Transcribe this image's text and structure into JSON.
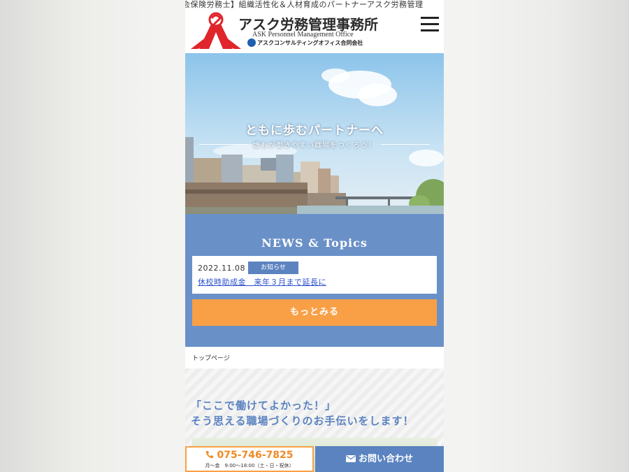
{
  "ticker": "会保険労務士】組織活性化＆人材育成のパートナーアスク労務管理",
  "header": {
    "logo_name_ja": "アスク労務管理事務所",
    "logo_name_en": "ASK Personnel Management Office",
    "logo_company": "アスクコンサルティングオフィス合同会社",
    "menu_icon": "hamburger-menu-icon"
  },
  "hero": {
    "title": "ともに歩むパートナーへ",
    "subtitle": "誰もが働きやすい職場をつくろう！"
  },
  "news": {
    "heading": "NEWS & Topics",
    "items": [
      {
        "date": "2022.11.08",
        "category": "お知らせ",
        "title": "休校時助成金　来年３月まで延長に"
      }
    ],
    "more_label": "もっとみる"
  },
  "breadcrumb": "トップページ",
  "intro": {
    "line1": "「ここで働けてよかった！」",
    "line2": "そう思える職場づくりのお手伝いをします！"
  },
  "footer": {
    "phone": "075-746-7825",
    "hours": "月〜金　9:00〜18:00（土・日・祝休）",
    "contact_label": "お問い合わせ"
  },
  "colors": {
    "accent_blue": "#5b83c0",
    "news_bg": "#6a90c8",
    "accent_orange": "#f9a047",
    "logo_red": "#e0252b"
  }
}
